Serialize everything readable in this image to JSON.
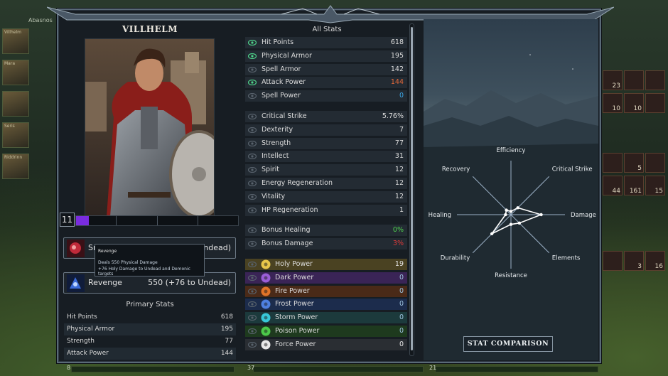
{
  "sidebar_party": [
    {
      "name": "Abasnos"
    },
    {
      "name": "Villhelm"
    },
    {
      "name": "Mara"
    },
    {
      "name": ""
    },
    {
      "name": "Seris"
    },
    {
      "name": "Riddrinn"
    }
  ],
  "character": {
    "name": "VILLHELM",
    "level": "11",
    "xp_progress": 0.08
  },
  "skills": [
    {
      "name": "Smite",
      "value": "550 (+76 to Undead)",
      "icon": "smite-icon"
    },
    {
      "name": "Revenge",
      "value": "550 (+76 to Undead)",
      "icon": "revenge-icon"
    }
  ],
  "tooltip": {
    "title": "Revenge",
    "line1": "Deals 550 Physical Damage",
    "line2": "+76 Holy Damage to Undead and Demonic targets"
  },
  "primary_stats": {
    "title": "Primary Stats",
    "rows": [
      {
        "label": "Hit Points",
        "value": "618"
      },
      {
        "label": "Physical Armor",
        "value": "195"
      },
      {
        "label": "Strength",
        "value": "77"
      },
      {
        "label": "Attack Power",
        "value": "144"
      }
    ]
  },
  "all_stats": {
    "title": "All Stats",
    "groups": [
      [
        {
          "label": "Hit Points",
          "value": "618",
          "tracked": true,
          "color": "#dcdcdc"
        },
        {
          "label": "Physical Armor",
          "value": "195",
          "tracked": true,
          "color": "#dcdcdc"
        },
        {
          "label": "Spell Armor",
          "value": "142",
          "tracked": false,
          "color": "#dcdcdc"
        },
        {
          "label": "Attack Power",
          "value": "144",
          "tracked": true,
          "color": "#e2683a"
        },
        {
          "label": "Spell Power",
          "value": "0",
          "tracked": false,
          "color": "#3aa6e6"
        }
      ],
      [
        {
          "label": "Critical Strike",
          "value": "5.76%",
          "tracked": false,
          "color": "#dcdcdc"
        },
        {
          "label": "Dexterity",
          "value": "7",
          "tracked": false,
          "color": "#dcdcdc"
        },
        {
          "label": "Strength",
          "value": "77",
          "tracked": false,
          "color": "#dcdcdc"
        },
        {
          "label": "Intellect",
          "value": "31",
          "tracked": false,
          "color": "#dcdcdc"
        },
        {
          "label": "Spirit",
          "value": "12",
          "tracked": false,
          "color": "#dcdcdc"
        },
        {
          "label": "Energy Regeneration",
          "value": "12",
          "tracked": false,
          "color": "#dcdcdc"
        },
        {
          "label": "Vitality",
          "value": "12",
          "tracked": false,
          "color": "#dcdcdc"
        },
        {
          "label": "HP Regeneration",
          "value": "1",
          "tracked": false,
          "color": "#dcdcdc"
        }
      ],
      [
        {
          "label": "Bonus Healing",
          "value": "0%",
          "tracked": false,
          "color": "#4fd24f"
        },
        {
          "label": "Bonus Damage",
          "value": "3%",
          "tracked": false,
          "color": "#e03a3a"
        }
      ]
    ],
    "powers": [
      {
        "label": "Holy Power",
        "value": "19",
        "icon": "holy-power-icon",
        "bg": "#4a4222",
        "icon_color": "#e8c64a",
        "value_color": "#e6e6e6"
      },
      {
        "label": "Dark Power",
        "value": "0",
        "icon": "dark-power-icon",
        "bg": "#3a2456",
        "icon_color": "#9a5ed6",
        "value_color": "#9ec4e0"
      },
      {
        "label": "Fire Power",
        "value": "0",
        "icon": "fire-power-icon",
        "bg": "#4a2a18",
        "icon_color": "#e07428",
        "value_color": "#9ec4e0"
      },
      {
        "label": "Frost Power",
        "value": "0",
        "icon": "frost-power-icon",
        "bg": "#1c2c4c",
        "icon_color": "#4e80e0",
        "value_color": "#9ec4e0"
      },
      {
        "label": "Storm Power",
        "value": "0",
        "icon": "storm-power-icon",
        "bg": "#1c3a3c",
        "icon_color": "#38c8d8",
        "value_color": "#9ec4e0"
      },
      {
        "label": "Poison Power",
        "value": "0",
        "icon": "poison-power-icon",
        "bg": "#1e3a1e",
        "icon_color": "#4cc84a",
        "value_color": "#9ec4e0"
      },
      {
        "label": "Force Power",
        "value": "0",
        "icon": "force-power-icon",
        "bg": "#2a2e33",
        "icon_color": "#e8e8e8",
        "value_color": "#e6e6e6"
      }
    ]
  },
  "radar": {
    "axes": [
      "Efficiency",
      "Critical Strike",
      "Damage",
      "Elements",
      "Resistance",
      "Durability",
      "Healing",
      "Recovery"
    ],
    "values": [
      0.06,
      0.18,
      0.56,
      0.22,
      0.18,
      0.5,
      0.1,
      0.12
    ]
  },
  "stat_comparison_label": "STAT COMPARISON",
  "inventory_counts": [
    "23",
    "10",
    "10",
    "5",
    "44",
    "161",
    "15",
    "3",
    "16"
  ],
  "hud": {
    "left": "8",
    "mid": "37",
    "right": "21"
  },
  "colors": {
    "accent": "#4fd24f",
    "panel": "#171d23",
    "row": "#232b33"
  }
}
